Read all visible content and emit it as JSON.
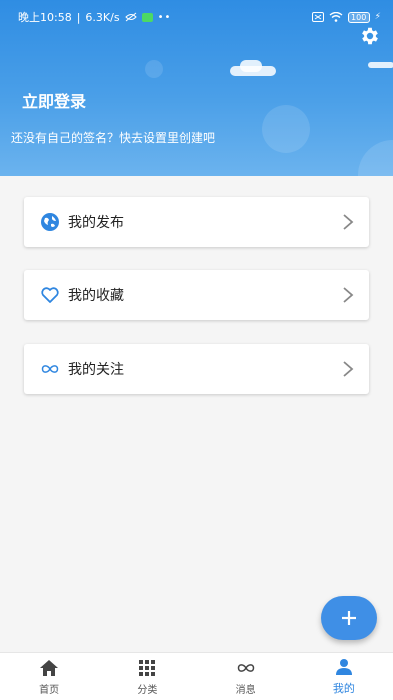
{
  "status_bar": {
    "time": "晚上10:58",
    "speed": "6.3K/s",
    "battery": "100"
  },
  "header": {
    "login_label": "立即登录",
    "signature": "还没有自己的签名？快去设置里创建吧"
  },
  "menu": {
    "items": [
      {
        "label": "我的发布",
        "icon": "globe-icon"
      },
      {
        "label": "我的收藏",
        "icon": "heart-icon"
      },
      {
        "label": "我的关注",
        "icon": "infinity-icon"
      }
    ]
  },
  "bottom_nav": {
    "items": [
      {
        "label": "首页",
        "icon": "home-icon"
      },
      {
        "label": "分类",
        "icon": "grid-icon"
      },
      {
        "label": "消息",
        "icon": "infinity-icon"
      },
      {
        "label": "我的",
        "icon": "person-icon",
        "active": true
      }
    ]
  },
  "colors": {
    "accent": "#2f86e0",
    "header_top": "#2f8de3",
    "fab": "#3f8fe6"
  }
}
